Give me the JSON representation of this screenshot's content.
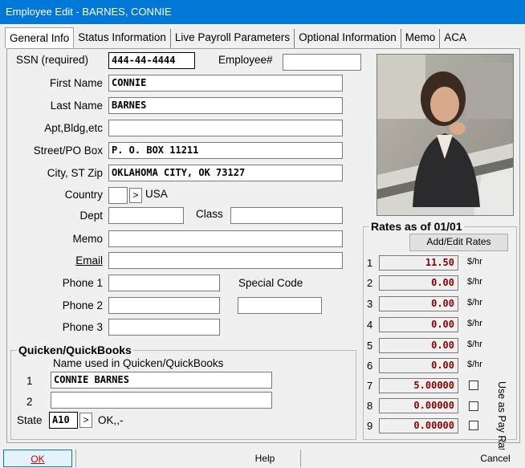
{
  "window": {
    "title": "Employee Edit - BARNES, CONNIE"
  },
  "tabs": [
    "General Info",
    "Status Information",
    "Live Payroll Parameters",
    "Optional Information",
    "Memo",
    "ACA"
  ],
  "form": {
    "ssn_label": "SSN (required)",
    "ssn": "444-44-4444",
    "employee_num_label": "Employee#",
    "employee_num": "",
    "first_name_label": "First Name",
    "first_name": "CONNIE",
    "last_name_label": "Last Name",
    "last_name": "BARNES",
    "apt_label": "Apt,Bldg,etc",
    "apt": "",
    "street_label": "Street/PO Box",
    "street": "P. O. BOX 11211",
    "city_label": "City, ST Zip",
    "city": "OKLAHOMA CITY, OK 73127",
    "country_label": "Country",
    "country_code": "",
    "country_name": "USA",
    "dept_label": "Dept",
    "dept": "",
    "class_label": "Class",
    "class": "",
    "memo_label": "Memo",
    "memo": "",
    "email_label": "Email",
    "email": "",
    "phone1_label": "Phone 1",
    "phone1": "",
    "phone2_label": "Phone 2",
    "phone2": "",
    "phone3_label": "Phone 3",
    "phone3": "",
    "special_code_label": "Special Code",
    "special_code": ""
  },
  "quickbooks": {
    "title": "Quicken/QuickBooks",
    "subtitle": "Name used in Quicken/QuickBooks",
    "row1_num": "1",
    "name1": "CONNIE BARNES",
    "row2_num": "2",
    "name2": "",
    "state_label": "State",
    "state_code": "A10",
    "state_desc": "OK,,-"
  },
  "rates": {
    "title": "Rates as of 01/01",
    "button": "Add/Edit Rates",
    "items": [
      {
        "num": "1",
        "value": "11.50",
        "unit": "$/hr"
      },
      {
        "num": "2",
        "value": "0.00",
        "unit": "$/hr"
      },
      {
        "num": "3",
        "value": "0.00",
        "unit": "$/hr"
      },
      {
        "num": "4",
        "value": "0.00",
        "unit": "$/hr"
      },
      {
        "num": "5",
        "value": "0.00",
        "unit": "$/hr"
      },
      {
        "num": "6",
        "value": "0.00",
        "unit": "$/hr"
      },
      {
        "num": "7",
        "value": "5.00000"
      },
      {
        "num": "8",
        "value": "0.00000"
      },
      {
        "num": "9",
        "value": "0.00000"
      }
    ],
    "use_as_pay_rate": "Use as Pay Rate"
  },
  "buttons": {
    "ok": "OK",
    "help": "Help",
    "cancel": "Cancel"
  },
  "small_button_glyph": ">",
  "colors": {
    "titlebar": "#0078d7",
    "rate_text": "#8b0000"
  }
}
